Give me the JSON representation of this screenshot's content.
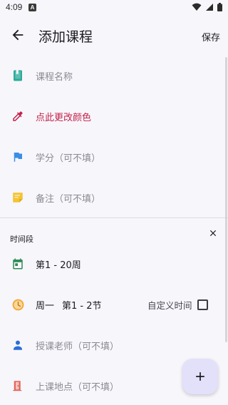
{
  "status_bar": {
    "time": "4:09",
    "notification_icon": "A",
    "icons": [
      "wifi-icon",
      "signal-icon",
      "battery-icon"
    ]
  },
  "app_bar": {
    "title": "添加课程",
    "save_label": "保存",
    "back_icon": "arrow-back-icon"
  },
  "form": {
    "course_name": {
      "placeholder": "课程名称",
      "icon": "book-icon",
      "icon_color": "#2bab9a"
    },
    "color": {
      "label": "点此更改颜色",
      "icon": "eyedropper-icon",
      "color": "#c5224b"
    },
    "credit": {
      "placeholder": "学分（可不填）",
      "icon": "flag-icon",
      "icon_color": "#3a8ee6"
    },
    "note": {
      "placeholder": "备注（可不填）",
      "icon": "sticky-note-icon",
      "icon_color": "#f4c430"
    }
  },
  "time_section": {
    "label": "时间段",
    "close_icon": "close-icon",
    "weeks": {
      "value": "第1 - 20周",
      "icon": "calendar-icon",
      "icon_color": "#2e8b57"
    },
    "time": {
      "day": "周一",
      "periods": "第1 - 2节",
      "icon": "clock-icon",
      "icon_color": "#f4a736",
      "custom_time_label": "自定义时间",
      "custom_time_checked": false
    },
    "teacher": {
      "placeholder": "授课老师（可不填）",
      "icon": "person-icon",
      "icon_color": "#2a6fd6"
    },
    "location": {
      "placeholder": "上课地点（可不填）",
      "icon": "door-icon",
      "icon_color": "#e0665a"
    }
  },
  "fab": {
    "label": "+",
    "icon": "add-icon"
  }
}
